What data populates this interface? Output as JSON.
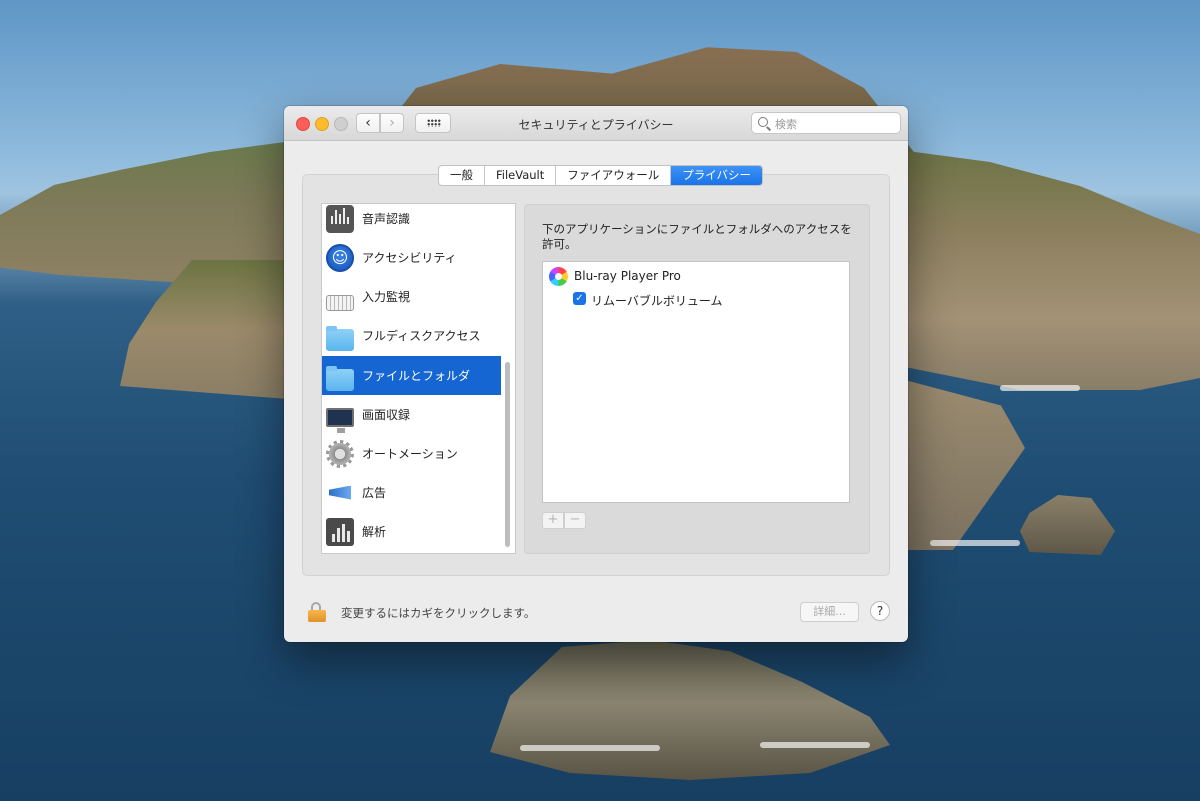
{
  "window": {
    "title": "セキュリティとプライバシー",
    "search_placeholder": "検索"
  },
  "tabs": [
    {
      "label": "一般",
      "active": false
    },
    {
      "label": "FileVault",
      "active": false
    },
    {
      "label": "ファイアウォール",
      "active": false
    },
    {
      "label": "プライバシー",
      "active": true
    }
  ],
  "sidebar": {
    "items": [
      {
        "label": "音声認識",
        "icon": "waveform-icon",
        "selected": false
      },
      {
        "label": "アクセシビリティ",
        "icon": "accessibility-icon",
        "selected": false
      },
      {
        "label": "入力監視",
        "icon": "keyboard-icon",
        "selected": false
      },
      {
        "label": "フルディスクアクセス",
        "icon": "folder-icon",
        "selected": false
      },
      {
        "label": "ファイルとフォルダ",
        "icon": "folder-icon",
        "selected": true
      },
      {
        "label": "画面収録",
        "icon": "display-icon",
        "selected": false
      },
      {
        "label": "オートメーション",
        "icon": "gear-icon",
        "selected": false
      },
      {
        "label": "広告",
        "icon": "megaphone-icon",
        "selected": false
      },
      {
        "label": "解析",
        "icon": "bar-chart-icon",
        "selected": false
      }
    ]
  },
  "main": {
    "description": "下のアプリケーションにファイルとフォルダへのアクセスを許可。",
    "apps": [
      {
        "name": "Blu-ray Player Pro",
        "permission": "リムーバブルボリューム",
        "checked": true
      }
    ],
    "add_label": "+",
    "remove_label": "−"
  },
  "footer": {
    "lock_text": "変更するにはカギをクリックします。",
    "details_label": "詳細...",
    "help_label": "?"
  },
  "colors": {
    "accent": "#1a73e8",
    "selection": "#1566d3",
    "close": "#fc5f57",
    "minimize": "#fdbc2e"
  }
}
